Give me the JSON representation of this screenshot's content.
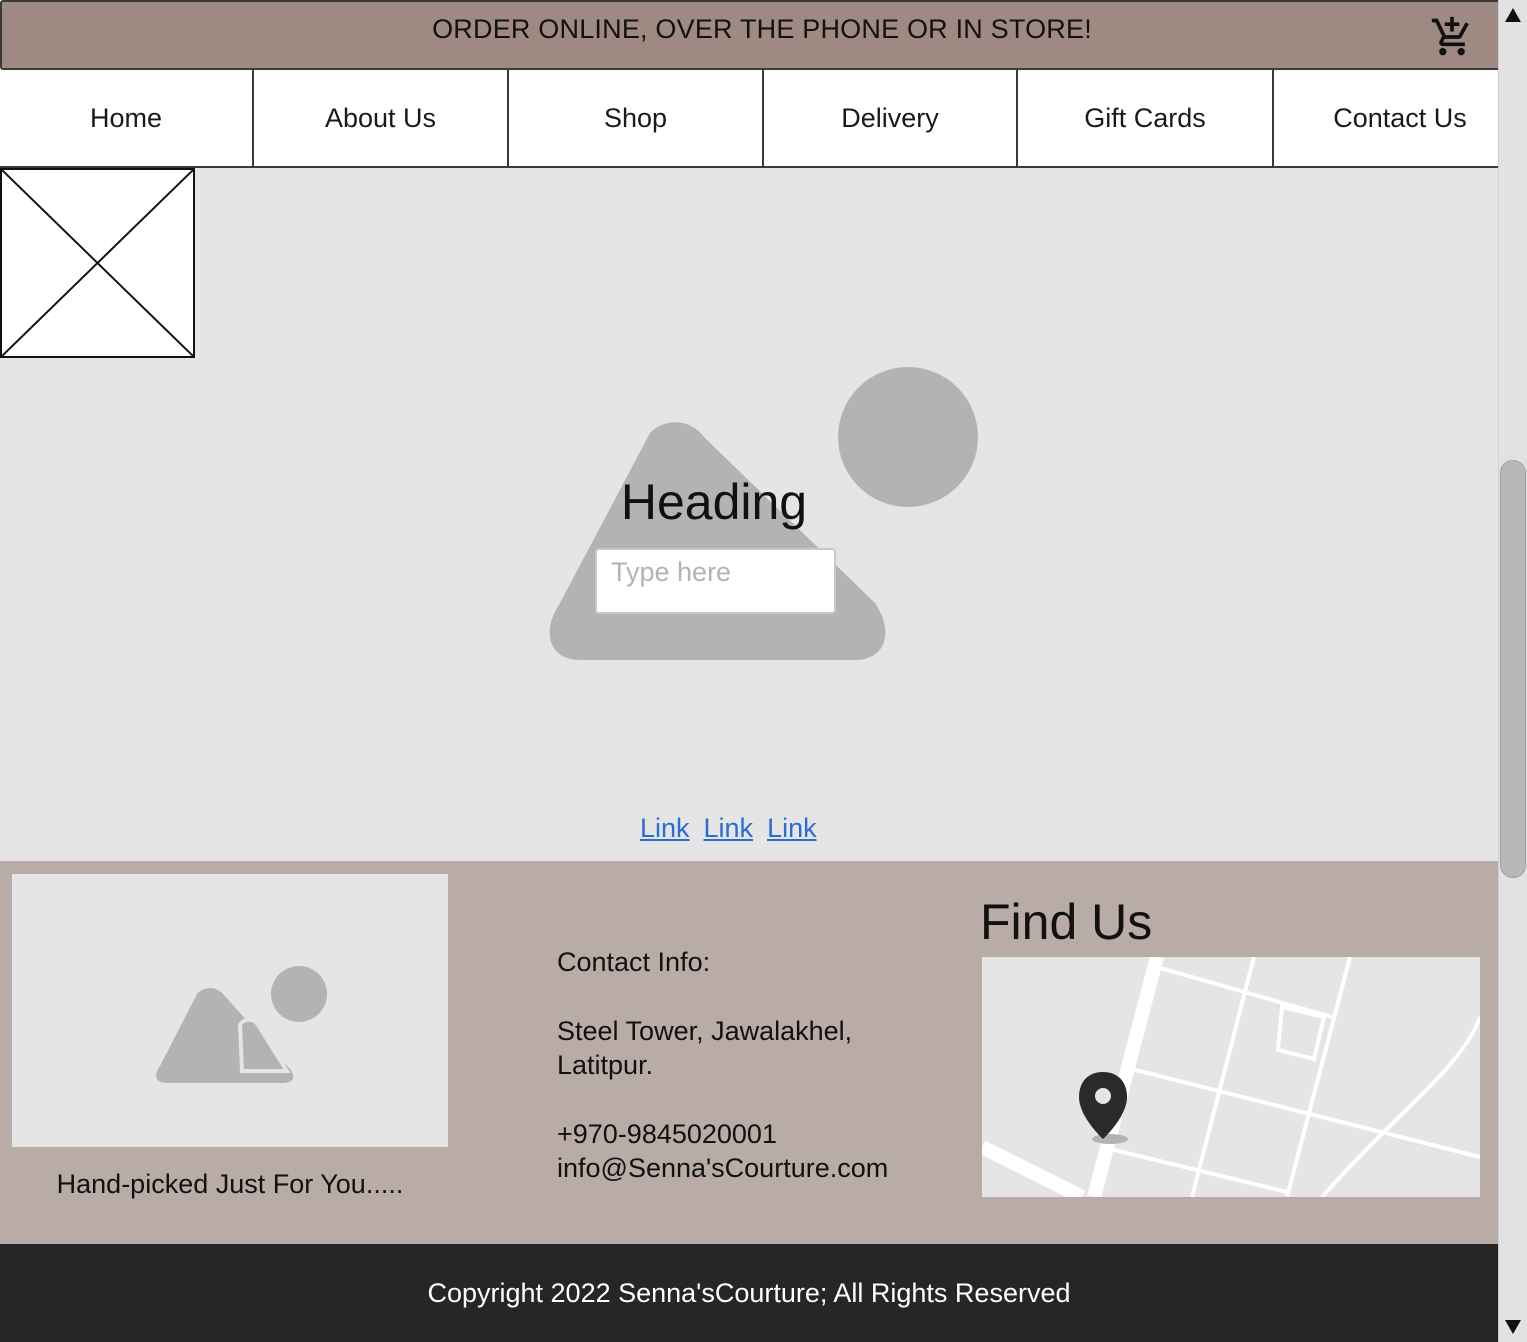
{
  "banner": {
    "text": "ORDER ONLINE, OVER THE PHONE OR IN STORE!",
    "cart_icon": "cart-add-icon"
  },
  "nav": {
    "items": [
      {
        "label": "Home"
      },
      {
        "label": "About Us"
      },
      {
        "label": "Shop"
      },
      {
        "label": "Delivery"
      },
      {
        "label": "Gift Cards"
      },
      {
        "label": "Contact Us"
      }
    ]
  },
  "hero": {
    "heading": "Heading",
    "input_placeholder": "Type here",
    "links": [
      "Link",
      "Link",
      "Link"
    ],
    "image_icon": "image-placeholder-icon"
  },
  "footer": {
    "image_caption": "Hand-picked Just For You.....",
    "contact": {
      "title": "Contact Info:",
      "address_line1": "Steel Tower, Jawalakhel,",
      "address_line2": "Latitpur.",
      "phone": "+970-9845020001",
      "email": "info@Senna'sCourture.com"
    },
    "find_us_title": "Find Us",
    "map_icon": "map-pin-icon"
  },
  "copyright": "Copyright 2022 Senna'sCourture; All Rights Reserved",
  "colors": {
    "banner_bg": "#9e8a82",
    "footer_bg": "#b9aba5",
    "main_bg": "#e5e5e5",
    "copyright_bg": "#262626",
    "link": "#2a6cd6"
  }
}
